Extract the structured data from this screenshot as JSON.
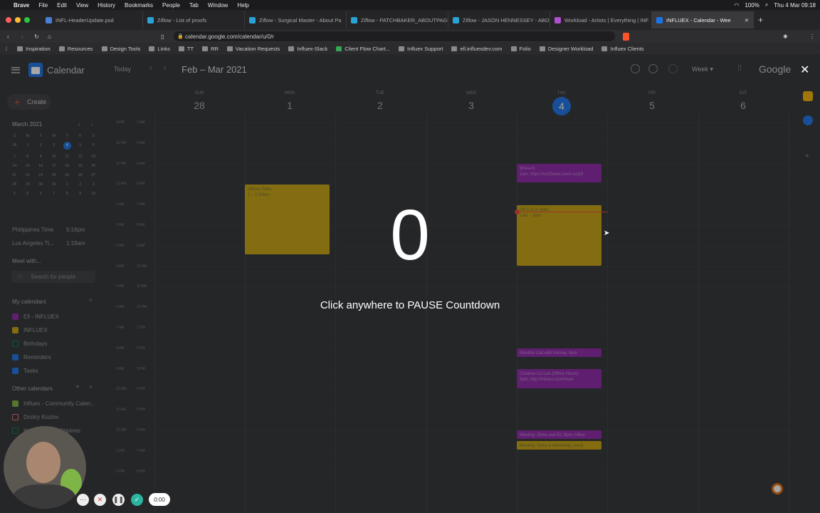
{
  "menubar": {
    "app": "Brave",
    "items": [
      "File",
      "Edit",
      "View",
      "History",
      "Bookmarks",
      "People",
      "Tab",
      "Window",
      "Help"
    ],
    "battery": "100%",
    "datetime": "Thu 4 Mar 09:18"
  },
  "tabs": [
    {
      "label": "INFL-HeaderUpdate.psd",
      "color": "#4a7fd4"
    },
    {
      "label": "Ziflow - List of proofs",
      "color": "#29a3d6"
    },
    {
      "label": "Ziflow - Surgical Master - About Pa",
      "color": "#29a3d6"
    },
    {
      "label": "Ziflow - PATCHBAKER_ABOUTPAGE",
      "color": "#29a3d6"
    },
    {
      "label": "Ziflow - JASON HENNESSEY - ABO",
      "color": "#29a3d6"
    },
    {
      "label": "Workload - Artists | Everything | INF",
      "color": "#b04fd0"
    },
    {
      "label": "INFLUEX - Calendar - Wee",
      "color": "#1a73e8",
      "active": true
    }
  ],
  "address": {
    "url": "calendar.google.com/calendar/u/0/r"
  },
  "bookmarks": [
    "Inspiration",
    "Resources",
    "Design Tools",
    "Links",
    "TT",
    "RR",
    "Vacation Requests",
    "Influex-Slack",
    "Client Flow Chart...",
    "Influex Support",
    "ell.influexdev.com",
    "Folio",
    "Designer Workload",
    "Influex Clients"
  ],
  "calendar": {
    "brand": "Calendar",
    "today_label": "Today",
    "range": "Feb – Mar 2021",
    "view": "Week",
    "google": "Google",
    "create": "Create",
    "days": [
      {
        "name": "SUN",
        "num": "28"
      },
      {
        "name": "MON",
        "num": "1"
      },
      {
        "name": "TUE",
        "num": "2"
      },
      {
        "name": "WED",
        "num": "3"
      },
      {
        "name": "THU",
        "num": "4",
        "current": true
      },
      {
        "name": "FRI",
        "num": "5"
      },
      {
        "name": "SAT",
        "num": "6"
      }
    ],
    "mini": {
      "title": "March 2021",
      "headers": [
        "S",
        "M",
        "T",
        "W",
        "T",
        "F",
        "S"
      ],
      "dates": [
        "28",
        "1",
        "2",
        "3",
        "4",
        "5",
        "6",
        "7",
        "8",
        "9",
        "10",
        "11",
        "12",
        "13",
        "14",
        "15",
        "16",
        "17",
        "18",
        "19",
        "20",
        "21",
        "22",
        "23",
        "24",
        "25",
        "26",
        "27",
        "28",
        "29",
        "30",
        "31",
        "1",
        "2",
        "3",
        "4",
        "5",
        "6",
        "7",
        "8",
        "9",
        "10"
      ],
      "selected": "4"
    },
    "timezones": [
      {
        "name": "Philippines Time",
        "time": "5:16pm"
      },
      {
        "name": "Los Angeles Ti...",
        "time": "1:18am"
      }
    ],
    "meet_with": "Meet with...",
    "search_people": "Search for people",
    "my_calendars_title": "My calendars",
    "my_calendars": [
      {
        "label": "Ell - INFLUEX",
        "color": "#8e24aa",
        "checked": true
      },
      {
        "label": "INFLUEX",
        "color": "#c9a30e",
        "checked": true
      },
      {
        "label": "Birthdays",
        "color": "#0b8043",
        "checked": false
      },
      {
        "label": "Reminders",
        "color": "#1a73e8",
        "checked": true
      },
      {
        "label": "Tasks",
        "color": "#1a73e8",
        "checked": true
      }
    ],
    "other_calendars_title": "Other calendars",
    "other_calendars": [
      {
        "label": "Influex - Community Calen...",
        "color": "#7cb342",
        "checked": true
      },
      {
        "label": "Dmitry Kozlov",
        "color": "#e67c73",
        "checked": false
      },
      {
        "label": "Holidays in Philippines",
        "color": "#0b8043",
        "checked": false
      }
    ],
    "times_left": [
      "9 PM",
      "10 PM",
      "11 PM",
      "12 AM",
      "1 AM",
      "2 AM",
      "3 AM",
      "4 AM",
      "5 AM",
      "6 AM",
      "7 AM",
      "8 AM",
      "9 AM",
      "10 AM",
      "11 AM",
      "12 PM",
      "1 PM",
      "2 PM"
    ],
    "times_right": [
      "3 AM",
      "4 AM",
      "5 AM",
      "6 AM",
      "7 AM",
      "8 AM",
      "9 AM",
      "10 AM",
      "11 AM",
      "12 PM",
      "1 PM",
      "2 PM",
      "3 PM",
      "4 PM",
      "5 PM",
      "6 PM",
      "7 PM",
      "8 PM"
    ],
    "events": [
      {
        "title": "Influex Hello",
        "detail": "1 – 2:30am",
        "color": "yellow"
      },
      {
        "title": "WAAAS",
        "detail": "1am, https://us02web.zoom.us/j/8",
        "color": "purple"
      },
      {
        "title": "INFLUEX Hello",
        "detail": "1am – 3am",
        "color": "yellow"
      },
      {
        "title": "Monthly Call with Kerney, 4pm",
        "detail": "",
        "color": "purple"
      },
      {
        "title": "Creative Co-Lab (Office Hours)",
        "detail": "5pm, http://influex.com/meet",
        "color": "purple"
      },
      {
        "title": "Meeting: Dima and Ell, 8pm, Influe",
        "detail": "",
        "color": "purple"
      },
      {
        "title": "Meeting: Dima & Marketing (Joni)",
        "detail": "",
        "color": "yellow"
      }
    ]
  },
  "overlay": {
    "countdown": "0",
    "message": "Click anywhere to PAUSE Countdown"
  },
  "recorder": {
    "timer": "0:00"
  }
}
